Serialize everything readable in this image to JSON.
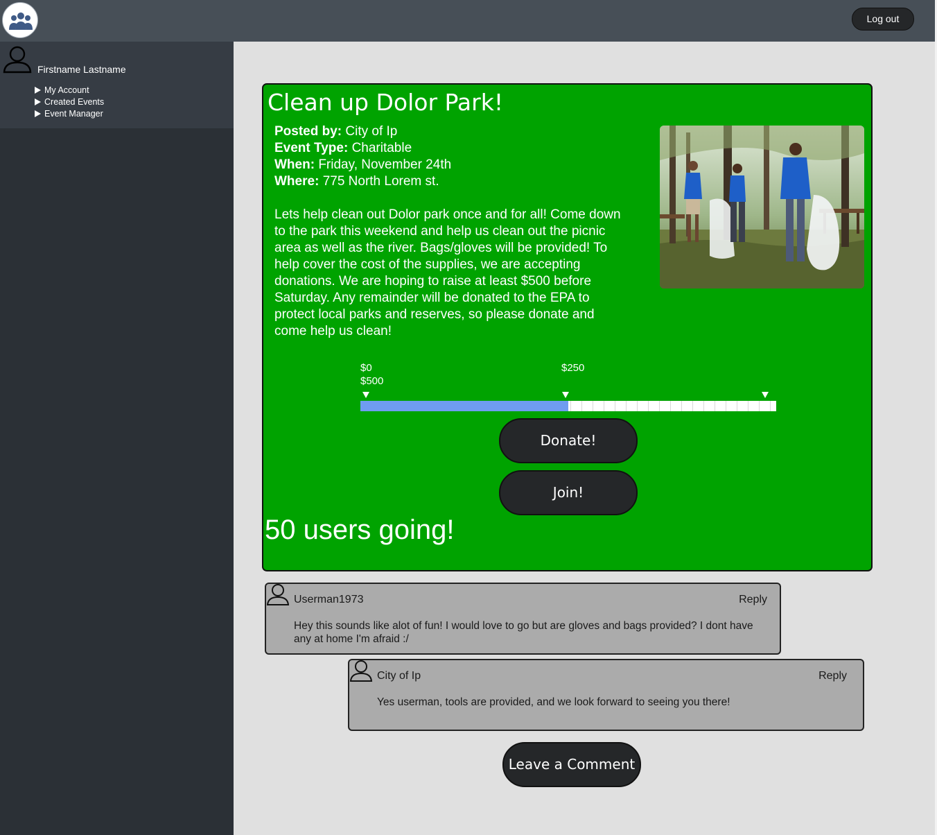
{
  "header": {
    "logout_label": "Log out",
    "logo_icon": "group-logo-icon"
  },
  "sidebar": {
    "user_name": "Firstname Lastname",
    "items": [
      {
        "label": "My Account"
      },
      {
        "label": "Created Events"
      },
      {
        "label": "Event Manager"
      }
    ]
  },
  "event": {
    "title": "Clean up Dolor Park!",
    "posted_by_label": "Posted by:",
    "posted_by": "City of Ip",
    "type_label": "Event Type:",
    "type": "Charitable",
    "when_label": "When:",
    "when": "Friday, November 24th",
    "where_label": "Where:",
    "where": "775 North Lorem st.",
    "description": "Lets help clean out Dolor park once and for all! Come down to the park this weekend and help us clean out the picnic area as well as the river. Bags/gloves will be provided! To help cover the cost of the supplies, we are accepting donations. We are hoping to raise at least $500 before Saturday. Any remainder will be donated to the EPA to protect local parks and reserves, so please donate and come help us clean!",
    "progress": {
      "min_label": "$0",
      "max_label": "$500",
      "mid_label": "$250",
      "fraction": 0.5,
      "fill_color": "#6f9cf0"
    },
    "donate_label": "Donate!",
    "join_label": "Join!",
    "going_text": "50 users going!",
    "card_color": "#00a300"
  },
  "comments": [
    {
      "author": "Userman1973",
      "reply_label": "Reply",
      "text": "Hey this sounds like alot of fun! I would love to go but are gloves and bags provided? I dont have any at home I'm afraid :/"
    },
    {
      "author": "City of Ip",
      "reply_label": "Reply",
      "text": "Yes userman, tools are provided, and we look forward to seeing you there!"
    }
  ],
  "leave_comment_label": "Leave a Comment"
}
